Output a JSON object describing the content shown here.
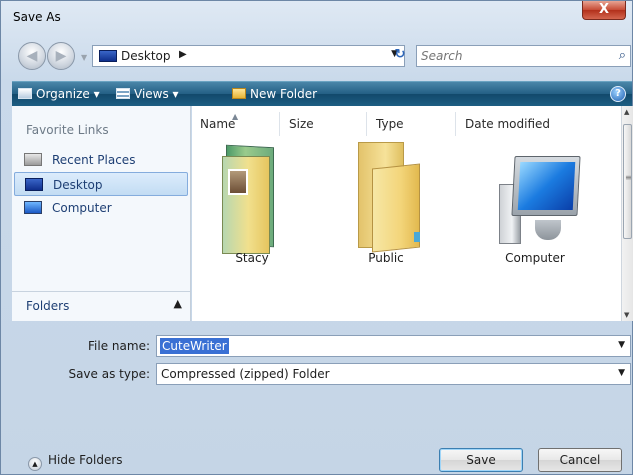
{
  "window": {
    "title": "Save As",
    "close_label": "X"
  },
  "navigation": {
    "back_label": "◀",
    "forward_label": "▶",
    "location": "Desktop",
    "search_placeholder": "Search"
  },
  "toolbar": {
    "organize_label": "Organize ▾",
    "views_label": "Views ▾",
    "new_folder_label": "New Folder",
    "help_label": "?"
  },
  "nav_pane": {
    "heading": "Favorite Links",
    "links": [
      {
        "label": "Recent Places",
        "icon": "recent-places-icon",
        "selected": false
      },
      {
        "label": "Desktop",
        "icon": "desktop-icon",
        "selected": true
      },
      {
        "label": "Computer",
        "icon": "computer-icon",
        "selected": false
      }
    ],
    "folders_label": "Folders"
  },
  "file_list": {
    "columns": [
      "Name",
      "Size",
      "Type",
      "Date modified"
    ],
    "items": [
      {
        "label": "Stacy",
        "icon": "user-folder-icon"
      },
      {
        "label": "Public",
        "icon": "folder-icon"
      },
      {
        "label": "Computer",
        "icon": "computer-icon"
      }
    ]
  },
  "form": {
    "file_name_label": "File name:",
    "file_name_value": "CuteWriter",
    "save_type_label": "Save as type:",
    "save_type_value": "Compressed (zipped) Folder"
  },
  "footer": {
    "hide_folders_label": "Hide Folders",
    "save_label": "Save",
    "cancel_label": "Cancel"
  },
  "colors": {
    "toolbar_gradient": "#235f84",
    "selection": "#3a70d4",
    "close_button": "#c64a34"
  }
}
